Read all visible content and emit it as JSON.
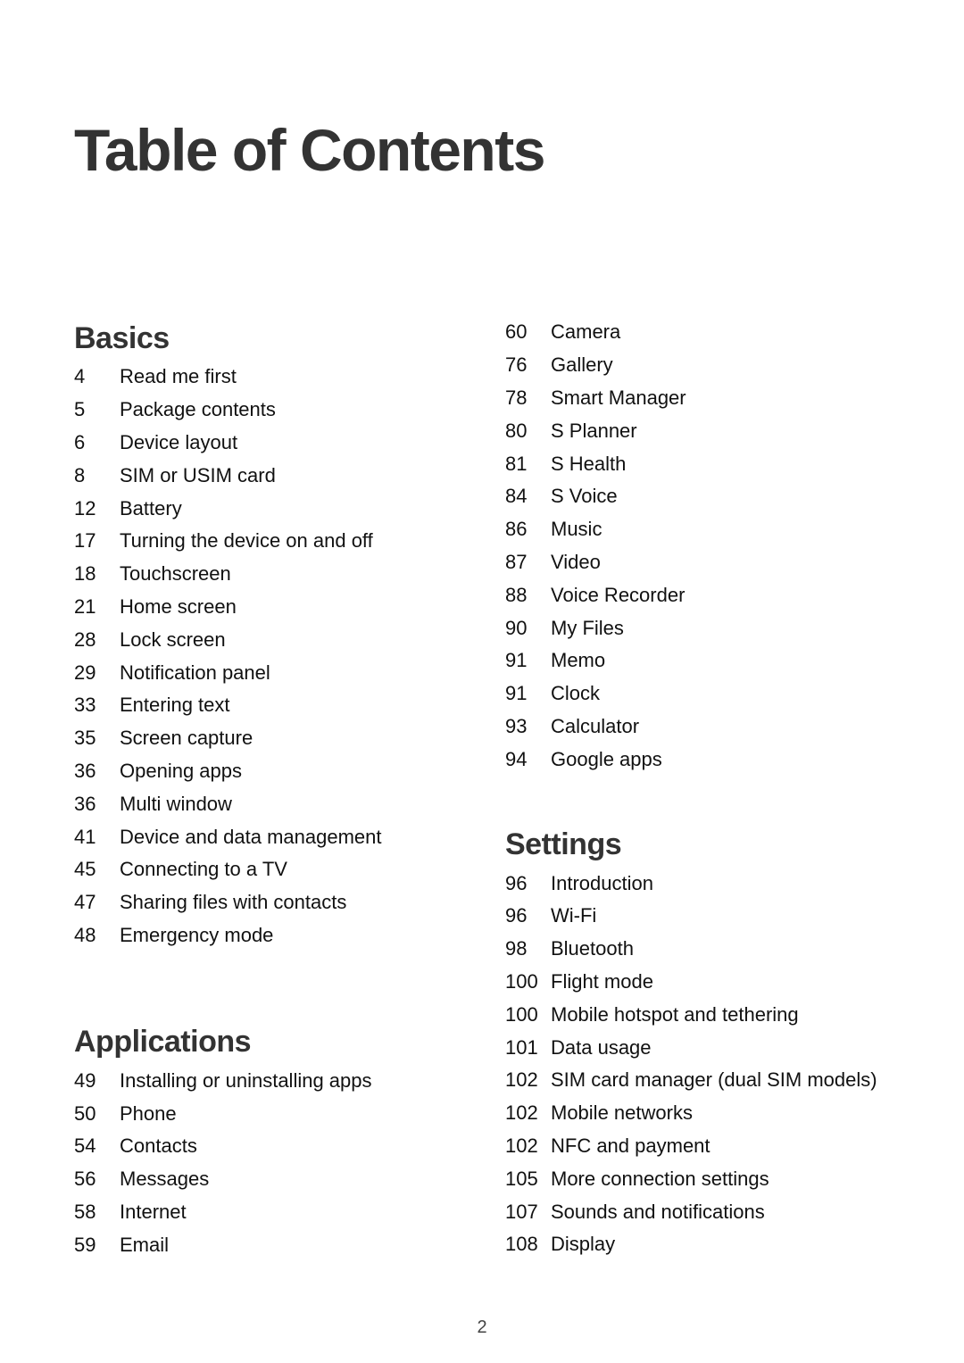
{
  "title": "Table of Contents",
  "sections": {
    "basics": {
      "heading": "Basics",
      "entries": [
        {
          "page": "4",
          "label": "Read me first"
        },
        {
          "page": "5",
          "label": "Package contents"
        },
        {
          "page": "6",
          "label": "Device layout"
        },
        {
          "page": "8",
          "label": "SIM or USIM card"
        },
        {
          "page": "12",
          "label": "Battery"
        },
        {
          "page": "17",
          "label": "Turning the device on and off"
        },
        {
          "page": "18",
          "label": "Touchscreen"
        },
        {
          "page": "21",
          "label": "Home screen"
        },
        {
          "page": "28",
          "label": "Lock screen"
        },
        {
          "page": "29",
          "label": "Notification panel"
        },
        {
          "page": "33",
          "label": "Entering text"
        },
        {
          "page": "35",
          "label": "Screen capture"
        },
        {
          "page": "36",
          "label": "Opening apps"
        },
        {
          "page": "36",
          "label": "Multi window"
        },
        {
          "page": "41",
          "label": "Device and data management"
        },
        {
          "page": "45",
          "label": "Connecting to a TV"
        },
        {
          "page": "47",
          "label": "Sharing files with contacts"
        },
        {
          "page": "48",
          "label": "Emergency mode"
        }
      ]
    },
    "applications": {
      "heading": "Applications",
      "entries": [
        {
          "page": "49",
          "label": "Installing or uninstalling apps"
        },
        {
          "page": "50",
          "label": "Phone"
        },
        {
          "page": "54",
          "label": "Contacts"
        },
        {
          "page": "56",
          "label": "Messages"
        },
        {
          "page": "58",
          "label": "Internet"
        },
        {
          "page": "59",
          "label": "Email"
        },
        {
          "page": "60",
          "label": "Camera"
        },
        {
          "page": "76",
          "label": "Gallery"
        },
        {
          "page": "78",
          "label": "Smart Manager"
        },
        {
          "page": "80",
          "label": "S Planner"
        },
        {
          "page": "81",
          "label": "S Health"
        },
        {
          "page": "84",
          "label": "S Voice"
        },
        {
          "page": "86",
          "label": "Music"
        },
        {
          "page": "87",
          "label": "Video"
        },
        {
          "page": "88",
          "label": "Voice Recorder"
        },
        {
          "page": "90",
          "label": "My Files"
        },
        {
          "page": "91",
          "label": "Memo"
        },
        {
          "page": "91",
          "label": "Clock"
        },
        {
          "page": "93",
          "label": "Calculator"
        },
        {
          "page": "94",
          "label": "Google apps"
        }
      ]
    },
    "settings": {
      "heading": "Settings",
      "entries": [
        {
          "page": "96",
          "label": "Introduction"
        },
        {
          "page": "96",
          "label": "Wi-Fi"
        },
        {
          "page": "98",
          "label": "Bluetooth"
        },
        {
          "page": "100",
          "label": "Flight mode"
        },
        {
          "page": "100",
          "label": "Mobile hotspot and tethering"
        },
        {
          "page": "101",
          "label": "Data usage"
        },
        {
          "page": "102",
          "label": "SIM card manager (dual SIM models)"
        },
        {
          "page": "102",
          "label": "Mobile networks"
        },
        {
          "page": "102",
          "label": "NFC and payment"
        },
        {
          "page": "105",
          "label": "More connection settings"
        },
        {
          "page": "107",
          "label": "Sounds and notifications"
        },
        {
          "page": "108",
          "label": "Display"
        }
      ]
    }
  },
  "page_number": "2"
}
